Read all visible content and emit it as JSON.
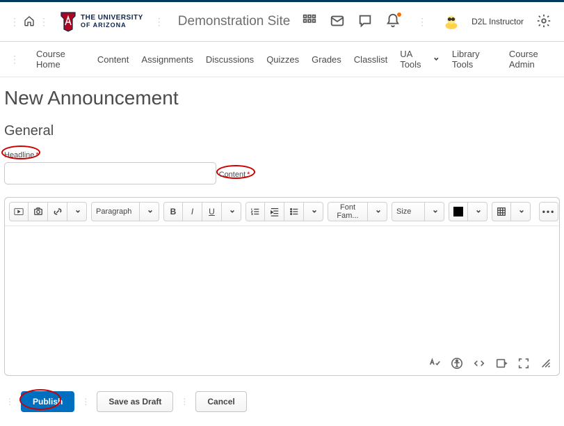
{
  "header": {
    "university": {
      "line1": "THE UNIVERSITY",
      "line2": "OF ARIZONA"
    },
    "site_name": "Demonstration Site",
    "username": "D2L Instructor"
  },
  "nav": {
    "items": [
      "Course Home",
      "Content",
      "Assignments",
      "Discussions",
      "Quizzes",
      "Grades",
      "Classlist",
      "UA Tools",
      "Library Tools",
      "Course Admin"
    ],
    "dropdown_index": 7
  },
  "page": {
    "title": "New Announcement",
    "section": "General",
    "headline_label": "Headline",
    "content_label": "Content",
    "required_mark": "*"
  },
  "editor": {
    "paragraph": "Paragraph",
    "font_family": "Font Fam...",
    "font_size": "Size",
    "more": "•••"
  },
  "actions": {
    "publish": "Publish",
    "save_draft": "Save as Draft",
    "cancel": "Cancel"
  }
}
